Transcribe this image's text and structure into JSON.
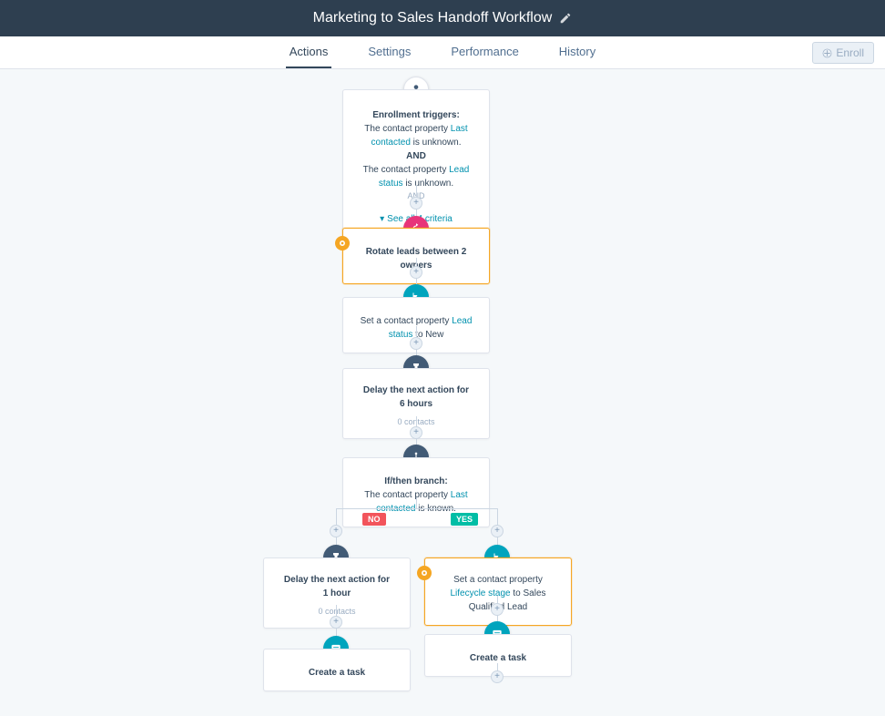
{
  "header": {
    "title": "Marketing to Sales Handoff Workflow"
  },
  "tabs": {
    "actions": "Actions",
    "settings": "Settings",
    "performance": "Performance",
    "history": "History"
  },
  "buttons": {
    "enroll": "Enroll"
  },
  "nodes": {
    "enrollTrigger": {
      "title": "Enrollment triggers:",
      "line1_prefix": "The contact property ",
      "line1_link": "Last contacted",
      "line1_suffix": " is unknown.",
      "and": "AND",
      "line2_prefix": "The contact property ",
      "line2_link": "Lead status",
      "line2_suffix": " is unknown.",
      "and2": "AND",
      "see_all": "See all 4 criteria"
    },
    "rotate": {
      "text": "Rotate leads between 2 owners"
    },
    "setLeadStatus": {
      "prefix": "Set a contact property ",
      "link": "Lead status",
      "suffix": " to New"
    },
    "delay6": {
      "line1": "Delay the next action for",
      "line2": "6 hours",
      "count": "0 contacts"
    },
    "branch": {
      "title": "If/then branch:",
      "prefix": "The contact property ",
      "link": "Last contacted",
      "suffix": " is known."
    },
    "badges": {
      "no": "NO",
      "yes": "YES"
    },
    "delay1": {
      "line1": "Delay the next action for",
      "line2": "1 hour",
      "count": "0 contacts"
    },
    "setLifecycle": {
      "prefix": "Set a contact property ",
      "link": "Lifecycle stage",
      "suffix": " to Sales Qualified Lead"
    },
    "createTaskLeft": {
      "text": "Create a task"
    },
    "createTaskRight": {
      "text": "Create a task"
    }
  }
}
